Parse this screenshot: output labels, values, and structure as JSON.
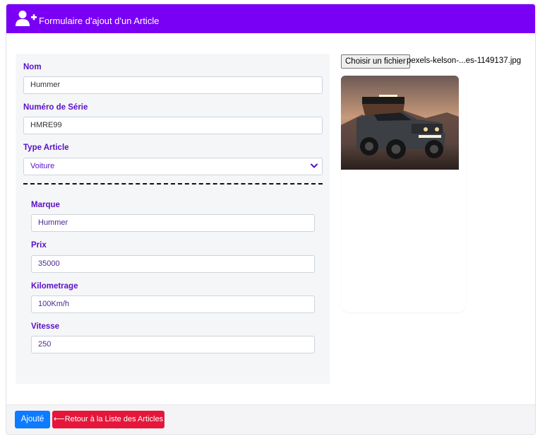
{
  "header": {
    "title": "Formulaire d'ajout d'un Article",
    "icon": "user-plus-icon",
    "color": "#7a00f5"
  },
  "form": {
    "nom": {
      "label": "Nom",
      "value": "Hummer"
    },
    "numero_serie": {
      "label": "Numéro de Série",
      "value": "HMRE99"
    },
    "type_article": {
      "label": "Type Article",
      "value": "Voiture"
    },
    "marque": {
      "label": "Marque",
      "value": "Hummer"
    },
    "prix": {
      "label": "Prix",
      "value": "35000"
    },
    "kilometrage": {
      "label": "Kilometrage",
      "value": "100Km/h"
    },
    "vitesse": {
      "label": "Vitesse",
      "value": "250"
    }
  },
  "file": {
    "button_label": "Choisir un fichier",
    "file_name": "pexels-kelson-...es-1149137.jpg"
  },
  "footer": {
    "add_label": "Ajouté",
    "back_label": "Retour à la Liste des Articles",
    "add_color": "#0d7bff",
    "back_color": "#e5163a"
  }
}
